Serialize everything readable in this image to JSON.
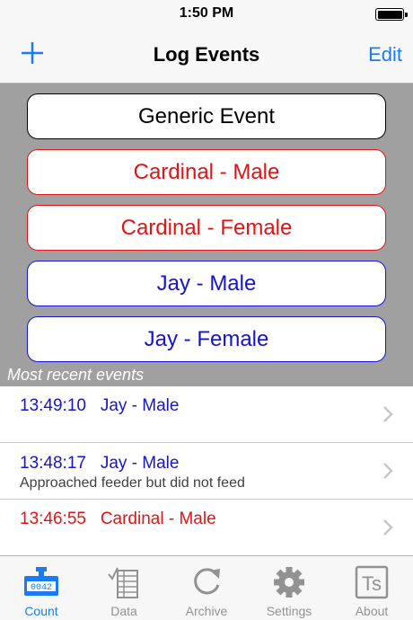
{
  "status_bar": {
    "time": "1:50 PM"
  },
  "nav": {
    "title": "Log Events",
    "edit_label": "Edit",
    "add_icon": "plus-icon"
  },
  "event_buttons": [
    {
      "label": "Generic Event",
      "color": "#000000"
    },
    {
      "label": "Cardinal - Male",
      "color": "#e31414"
    },
    {
      "label": "Cardinal - Female",
      "color": "#e31414"
    },
    {
      "label": "Jay - Male",
      "color": "#1414d2"
    },
    {
      "label": "Jay - Female",
      "color": "#1414d2"
    }
  ],
  "recent": {
    "header": "Most recent events",
    "events": [
      {
        "time": "13:49:10",
        "name": "Jay - Male",
        "note": "",
        "color": "#1414d2"
      },
      {
        "time": "13:48:17",
        "name": "Jay - Male",
        "note": "Approached feeder but did not feed",
        "color": "#1414d2"
      },
      {
        "time": "13:46:55",
        "name": "Cardinal - Male",
        "note": "",
        "color": "#e31414"
      }
    ]
  },
  "tabs": [
    {
      "label": "Count",
      "icon": "counter-icon",
      "active": true
    },
    {
      "label": "Data",
      "icon": "data-list-icon",
      "active": false
    },
    {
      "label": "Archive",
      "icon": "archive-refresh-icon",
      "active": false
    },
    {
      "label": "Settings",
      "icon": "gear-icon",
      "active": false
    },
    {
      "label": "About",
      "icon": "about-ts-icon",
      "active": false
    }
  ],
  "counter_icon_text": "0042",
  "about_icon_text": "Ts",
  "colors": {
    "accent": "#1b7cf2",
    "panel_bg": "#a0a0a0",
    "tab_inactive": "#929292"
  }
}
